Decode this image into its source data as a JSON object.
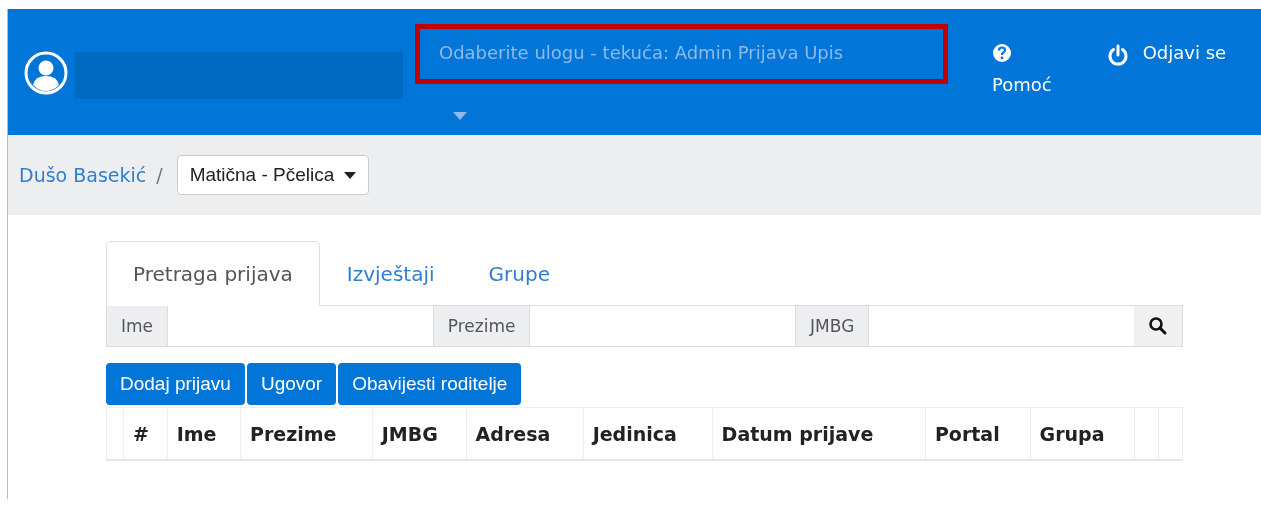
{
  "header": {
    "role_selector": {
      "text": "Odaberite ulogu - tekuća: Admin Prijava Upis",
      "highlighted": true
    },
    "actions": [
      {
        "kind": "help",
        "label": "Pomoć"
      },
      {
        "kind": "logout",
        "label": "Odjavi se"
      }
    ]
  },
  "breadcrumb": {
    "link": "Dušo Basekić",
    "separator": "/",
    "dropdown": "Matična - Pčelica"
  },
  "tabs": [
    {
      "label": "Pretraga prijava",
      "selected": true
    },
    {
      "label": "Izvještaji",
      "selected": false
    },
    {
      "label": "Grupe",
      "selected": false
    }
  ],
  "search": {
    "fields": [
      {
        "label": "Ime"
      },
      {
        "label": "Prezime"
      },
      {
        "label": "JMBG"
      }
    ]
  },
  "buttons": [
    "Dodaj prijavu",
    "Ugovor",
    "Obavijesti roditelje"
  ],
  "table": {
    "columns": [
      "#",
      "Ime",
      "Prezime",
      "JMBG",
      "Adresa",
      "Jedinica",
      "Datum prijave",
      "Portal",
      "Grupa"
    ]
  }
}
